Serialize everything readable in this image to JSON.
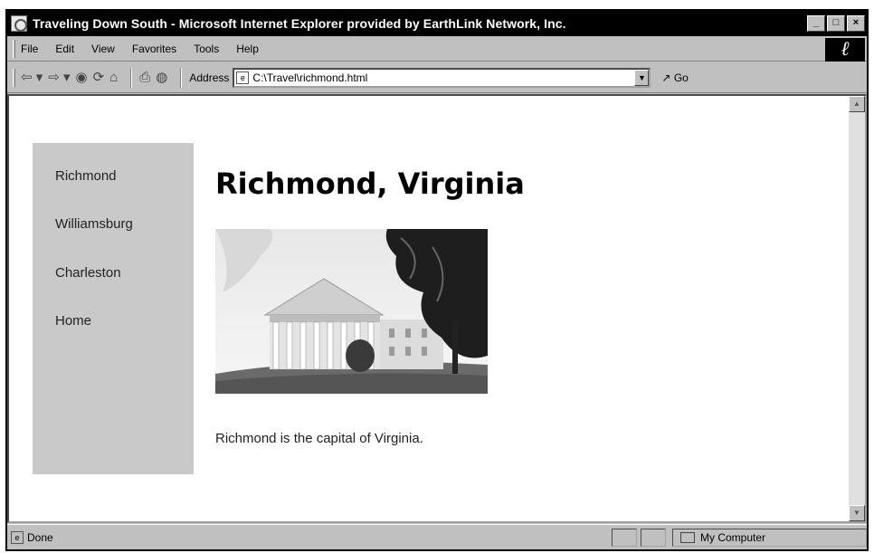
{
  "window": {
    "title": "Traveling Down South - Microsoft Internet Explorer provided by EarthLink Network, Inc.",
    "buttons": [
      "_",
      "□",
      "×"
    ]
  },
  "menu": {
    "items": [
      "File",
      "Edit",
      "View",
      "Favorites",
      "Tools",
      "Help"
    ]
  },
  "toolbar": {
    "icons": [
      "back-icon",
      "forward-icon",
      "stop-icon",
      "refresh-icon",
      "home-icon",
      "print-icon",
      "edit-icon"
    ],
    "address_label": "Address",
    "address_value": "C:\\Travel\\richmond.html",
    "go_label": "Go"
  },
  "sidebar": {
    "links": [
      "Richmond",
      "Williamsburg",
      "Charleston",
      "Home"
    ]
  },
  "main": {
    "title": "Richmond, Virginia",
    "caption": "Richmond is the capital of Virginia."
  },
  "status": {
    "text": "Done",
    "zone": "My Computer"
  }
}
